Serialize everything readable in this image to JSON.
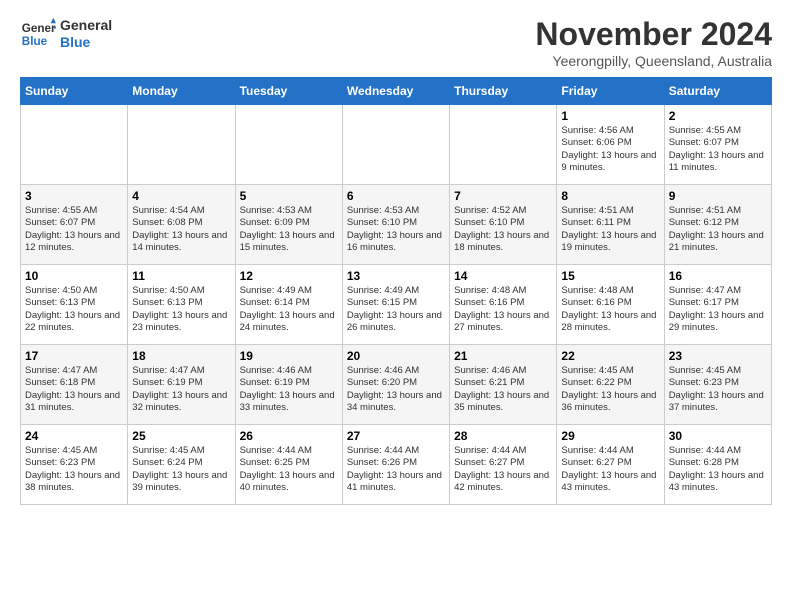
{
  "logo": {
    "text_general": "General",
    "text_blue": "Blue"
  },
  "title": "November 2024",
  "subtitle": "Yeerongpilly, Queensland, Australia",
  "days_of_week": [
    "Sunday",
    "Monday",
    "Tuesday",
    "Wednesday",
    "Thursday",
    "Friday",
    "Saturday"
  ],
  "weeks": [
    [
      {
        "day": "",
        "info": ""
      },
      {
        "day": "",
        "info": ""
      },
      {
        "day": "",
        "info": ""
      },
      {
        "day": "",
        "info": ""
      },
      {
        "day": "",
        "info": ""
      },
      {
        "day": "1",
        "info": "Sunrise: 4:56 AM\nSunset: 6:06 PM\nDaylight: 13 hours and 9 minutes."
      },
      {
        "day": "2",
        "info": "Sunrise: 4:55 AM\nSunset: 6:07 PM\nDaylight: 13 hours and 11 minutes."
      }
    ],
    [
      {
        "day": "3",
        "info": "Sunrise: 4:55 AM\nSunset: 6:07 PM\nDaylight: 13 hours and 12 minutes."
      },
      {
        "day": "4",
        "info": "Sunrise: 4:54 AM\nSunset: 6:08 PM\nDaylight: 13 hours and 14 minutes."
      },
      {
        "day": "5",
        "info": "Sunrise: 4:53 AM\nSunset: 6:09 PM\nDaylight: 13 hours and 15 minutes."
      },
      {
        "day": "6",
        "info": "Sunrise: 4:53 AM\nSunset: 6:10 PM\nDaylight: 13 hours and 16 minutes."
      },
      {
        "day": "7",
        "info": "Sunrise: 4:52 AM\nSunset: 6:10 PM\nDaylight: 13 hours and 18 minutes."
      },
      {
        "day": "8",
        "info": "Sunrise: 4:51 AM\nSunset: 6:11 PM\nDaylight: 13 hours and 19 minutes."
      },
      {
        "day": "9",
        "info": "Sunrise: 4:51 AM\nSunset: 6:12 PM\nDaylight: 13 hours and 21 minutes."
      }
    ],
    [
      {
        "day": "10",
        "info": "Sunrise: 4:50 AM\nSunset: 6:13 PM\nDaylight: 13 hours and 22 minutes."
      },
      {
        "day": "11",
        "info": "Sunrise: 4:50 AM\nSunset: 6:13 PM\nDaylight: 13 hours and 23 minutes."
      },
      {
        "day": "12",
        "info": "Sunrise: 4:49 AM\nSunset: 6:14 PM\nDaylight: 13 hours and 24 minutes."
      },
      {
        "day": "13",
        "info": "Sunrise: 4:49 AM\nSunset: 6:15 PM\nDaylight: 13 hours and 26 minutes."
      },
      {
        "day": "14",
        "info": "Sunrise: 4:48 AM\nSunset: 6:16 PM\nDaylight: 13 hours and 27 minutes."
      },
      {
        "day": "15",
        "info": "Sunrise: 4:48 AM\nSunset: 6:16 PM\nDaylight: 13 hours and 28 minutes."
      },
      {
        "day": "16",
        "info": "Sunrise: 4:47 AM\nSunset: 6:17 PM\nDaylight: 13 hours and 29 minutes."
      }
    ],
    [
      {
        "day": "17",
        "info": "Sunrise: 4:47 AM\nSunset: 6:18 PM\nDaylight: 13 hours and 31 minutes."
      },
      {
        "day": "18",
        "info": "Sunrise: 4:47 AM\nSunset: 6:19 PM\nDaylight: 13 hours and 32 minutes."
      },
      {
        "day": "19",
        "info": "Sunrise: 4:46 AM\nSunset: 6:19 PM\nDaylight: 13 hours and 33 minutes."
      },
      {
        "day": "20",
        "info": "Sunrise: 4:46 AM\nSunset: 6:20 PM\nDaylight: 13 hours and 34 minutes."
      },
      {
        "day": "21",
        "info": "Sunrise: 4:46 AM\nSunset: 6:21 PM\nDaylight: 13 hours and 35 minutes."
      },
      {
        "day": "22",
        "info": "Sunrise: 4:45 AM\nSunset: 6:22 PM\nDaylight: 13 hours and 36 minutes."
      },
      {
        "day": "23",
        "info": "Sunrise: 4:45 AM\nSunset: 6:23 PM\nDaylight: 13 hours and 37 minutes."
      }
    ],
    [
      {
        "day": "24",
        "info": "Sunrise: 4:45 AM\nSunset: 6:23 PM\nDaylight: 13 hours and 38 minutes."
      },
      {
        "day": "25",
        "info": "Sunrise: 4:45 AM\nSunset: 6:24 PM\nDaylight: 13 hours and 39 minutes."
      },
      {
        "day": "26",
        "info": "Sunrise: 4:44 AM\nSunset: 6:25 PM\nDaylight: 13 hours and 40 minutes."
      },
      {
        "day": "27",
        "info": "Sunrise: 4:44 AM\nSunset: 6:26 PM\nDaylight: 13 hours and 41 minutes."
      },
      {
        "day": "28",
        "info": "Sunrise: 4:44 AM\nSunset: 6:27 PM\nDaylight: 13 hours and 42 minutes."
      },
      {
        "day": "29",
        "info": "Sunrise: 4:44 AM\nSunset: 6:27 PM\nDaylight: 13 hours and 43 minutes."
      },
      {
        "day": "30",
        "info": "Sunrise: 4:44 AM\nSunset: 6:28 PM\nDaylight: 13 hours and 43 minutes."
      }
    ]
  ]
}
